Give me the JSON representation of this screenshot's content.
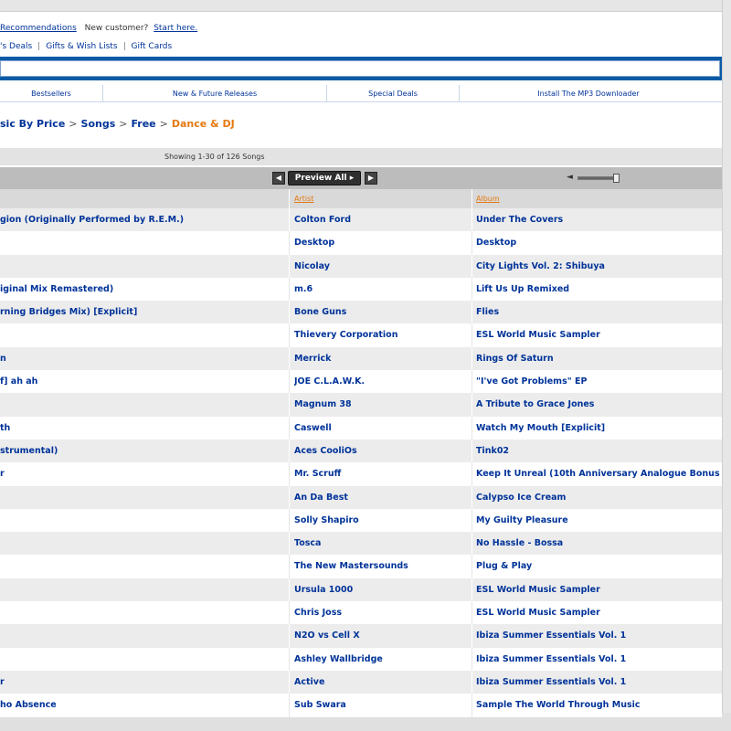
{
  "header": {
    "recommendations_link": "Recommendations",
    "new_customer_text": "New customer?",
    "start_here_link": "Start here."
  },
  "quicklinks": [
    "'s Deals",
    "Gifts & Wish Lists",
    "Gift Cards"
  ],
  "search": {
    "value": ""
  },
  "subnav": [
    "Bestsellers",
    "New & Future Releases",
    "Special Deals",
    "Install The MP3 Downloader"
  ],
  "breadcrumb": {
    "items": [
      "sic By Price",
      "Songs",
      "Free"
    ],
    "current": "Dance & DJ"
  },
  "results": {
    "showing_text": "Showing 1-30 of 126 Songs"
  },
  "player": {
    "preview_all_label": "Preview All",
    "prev_icon": "rewind-icon",
    "next_icon": "fast-forward-icon",
    "volume_icon": "speaker-icon",
    "volume_level": 0.9
  },
  "table": {
    "columns": [
      "",
      "Artist",
      "Album"
    ],
    "rows": [
      [
        "gion (Originally Performed by R.E.M.)",
        "Colton Ford",
        "Under The Covers"
      ],
      [
        "",
        "Desktop",
        "Desktop"
      ],
      [
        "",
        "Nicolay",
        "City Lights Vol. 2: Shibuya"
      ],
      [
        "iginal Mix Remastered)",
        "m.6",
        "Lift Us Up Remixed"
      ],
      [
        "rning Bridges Mix) [Explicit]",
        "Bone Guns",
        "Flies"
      ],
      [
        "",
        "Thievery Corporation",
        "ESL World Music Sampler"
      ],
      [
        "n",
        "Merrick",
        "Rings Of Saturn"
      ],
      [
        "f] ah ah",
        "JOE C.L.A.W.K.",
        "\"I've Got Problems\" EP"
      ],
      [
        "",
        "Magnum 38",
        "A Tribute to Grace Jones"
      ],
      [
        "th",
        "Caswell",
        "Watch My Mouth [Explicit]"
      ],
      [
        "strumental)",
        "Aces CooliOs",
        "Tink02"
      ],
      [
        "r",
        "Mr. Scruff",
        "Keep It Unreal (10th Anniversary Analogue Bonus"
      ],
      [
        "",
        "An Da Best",
        "Calypso Ice Cream"
      ],
      [
        "",
        "Solly Shapiro",
        "My Guilty Pleasure"
      ],
      [
        "",
        "Tosca",
        "No Hassle - Bossa"
      ],
      [
        "",
        "The New Mastersounds",
        "Plug & Play"
      ],
      [
        "",
        "Ursula 1000",
        "ESL World Music Sampler"
      ],
      [
        "",
        "Chris Joss",
        "ESL World Music Sampler"
      ],
      [
        "",
        "N2O vs Cell X",
        "Ibiza Summer Essentials Vol. 1"
      ],
      [
        "",
        "Ashley Wallbridge",
        "Ibiza Summer Essentials Vol. 1"
      ],
      [
        "r",
        "Active",
        "Ibiza Summer Essentials Vol. 1"
      ],
      [
        "ho Absence",
        "Sub Swara",
        "Sample The World Through Music"
      ]
    ]
  }
}
